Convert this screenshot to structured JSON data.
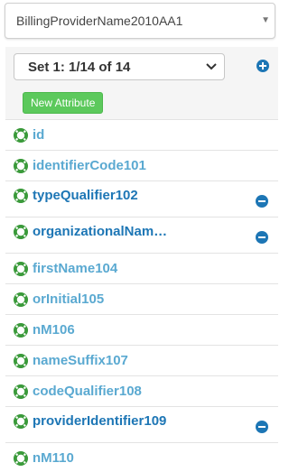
{
  "segment_select": {
    "value": "BillingProviderName2010AA1"
  },
  "set_section": {
    "set_value": "Set 1: 1/14 of 14",
    "new_attribute_label": "New Attribute"
  },
  "attributes": [
    {
      "label": "id",
      "expanded": false
    },
    {
      "label": "identifierCode101",
      "expanded": false
    },
    {
      "label": "typeQualifier102",
      "expanded": true
    },
    {
      "label": "organizationalNam…",
      "expanded": true
    },
    {
      "label": "firstName104",
      "expanded": false
    },
    {
      "label": "orInitial105",
      "expanded": false
    },
    {
      "label": "nM106",
      "expanded": false
    },
    {
      "label": "nameSuffix107",
      "expanded": false
    },
    {
      "label": "codeQualifier108",
      "expanded": false
    },
    {
      "label": "providerIdentifier109",
      "expanded": true
    },
    {
      "label": "nM110",
      "expanded": false
    }
  ],
  "colors": {
    "link_light": "#5aa9d1",
    "link_dark": "#1d76b5",
    "icon_green": "#3a9a3a",
    "button_green": "#5cc95c",
    "icon_blue": "#1d76b5"
  },
  "icons": {
    "attribute": "lifebuoy-icon",
    "remove": "minus-circle-icon",
    "add": "plus-circle-icon",
    "dropdown": "chevron-down-icon"
  }
}
